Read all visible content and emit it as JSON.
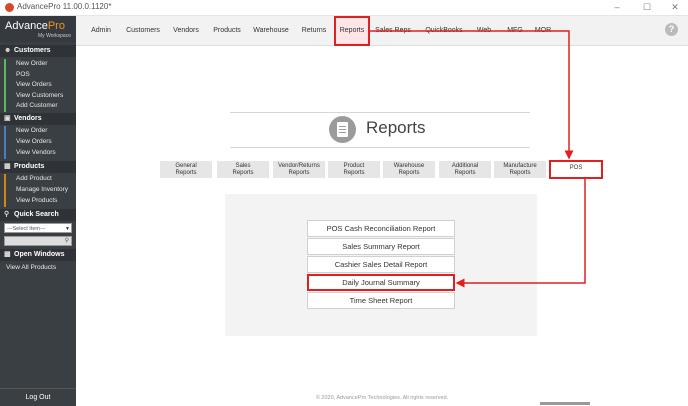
{
  "window": {
    "title": "AdvancePro 11.00.0.1120*",
    "minimize": "–",
    "maximize": "☐",
    "close": "✕"
  },
  "logo": {
    "brand_main": "Advance",
    "brand_accent": "Pro",
    "workspace": "My Workspace"
  },
  "sidebar": {
    "customers": {
      "title": "Customers",
      "items": [
        "New Order",
        "POS",
        "View Orders",
        "View Customers",
        "Add Customer"
      ]
    },
    "vendors": {
      "title": "Vendors",
      "items": [
        "New Order",
        "View Orders",
        "View Vendors"
      ]
    },
    "products": {
      "title": "Products",
      "items": [
        "Add Product",
        "Manage Inventory",
        "View Products"
      ]
    },
    "quick_search": {
      "title": "Quick Search",
      "select_value": "---Select Item---"
    },
    "open_windows": {
      "title": "Open Windows",
      "view_all": "View All Products"
    },
    "logout": "Log Out"
  },
  "topnav": [
    "Admin",
    "Customers",
    "Vendors",
    "Products",
    "Warehouse",
    "Returns",
    "Reports",
    "Sales Reps",
    "QuickBooks",
    "Web",
    "MFG",
    "MOR"
  ],
  "help": "?",
  "page": {
    "title": "Reports"
  },
  "categories": [
    [
      "General",
      "Reports"
    ],
    [
      "Sales",
      "Reports"
    ],
    [
      "Vendor/Returns",
      "Reports"
    ],
    [
      "Product",
      "Reports"
    ],
    [
      "Warehouse",
      "Reports"
    ],
    [
      "Additional",
      "Reports"
    ],
    [
      "Manufacture",
      "Reports"
    ],
    [
      "POS",
      ""
    ]
  ],
  "reports": [
    "POS Cash Reconciliation Report",
    "Sales Summary Report",
    "Cashier Sales Detail Report",
    "Daily Journal Summary",
    "Time Sheet Report"
  ],
  "footer": "© 2020, AdvancePro Technologies. All rights reserved.",
  "colors": {
    "highlight": "#e02020",
    "sidebar": "#3a3f44",
    "accent": "#f7941d"
  }
}
